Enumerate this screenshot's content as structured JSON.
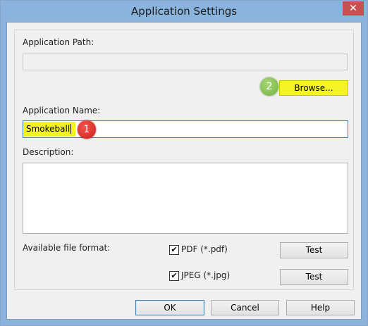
{
  "window": {
    "title": "Application Settings",
    "close_glyph": "✕"
  },
  "form": {
    "app_path_label": "Application Path:",
    "app_path_value": "",
    "browse_label": "Browse...",
    "app_name_label": "Application Name:",
    "app_name_value": "Smokeball",
    "description_label": "Description:",
    "description_value": "",
    "file_format_label": "Available file format:"
  },
  "formats": [
    {
      "label": "PDF (*.pdf)",
      "checked": true,
      "test_label": "Test"
    },
    {
      "label": "JPEG (*.jpg)",
      "checked": true,
      "test_label": "Test"
    }
  ],
  "footer": {
    "ok_label": "OK",
    "cancel_label": "Cancel",
    "help_label": "Help"
  },
  "annotations": {
    "step1": "1",
    "step2": "2"
  },
  "colors": {
    "highlight": "#f4f425",
    "badge_red": "#d9302a",
    "badge_green": "#8bc459"
  }
}
